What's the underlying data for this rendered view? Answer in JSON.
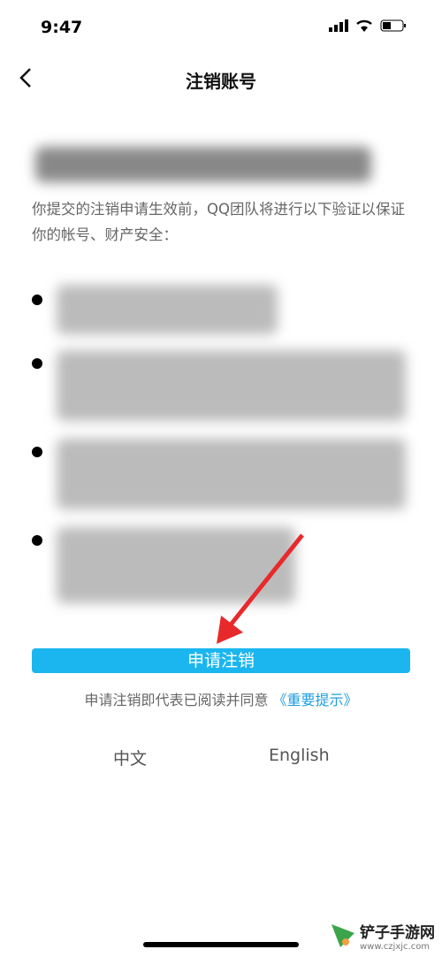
{
  "status_bar": {
    "time": "9:47"
  },
  "header": {
    "title": "注销账号"
  },
  "intro": "你提交的注销申请生效前，QQ团队将进行以下验证以保证你的帐号、财产安全：",
  "apply_button": "申请注销",
  "agreement": {
    "text": "申请注销即代表已阅读并同意",
    "link": "《重要提示》"
  },
  "languages": [
    "中文",
    "English"
  ],
  "watermark": {
    "name": "铲子手游网",
    "url": "www.czjxjc.com"
  },
  "colors": {
    "accent": "#1bb6ef",
    "link": "#1d9ee0",
    "arrow": "#e8292b"
  }
}
